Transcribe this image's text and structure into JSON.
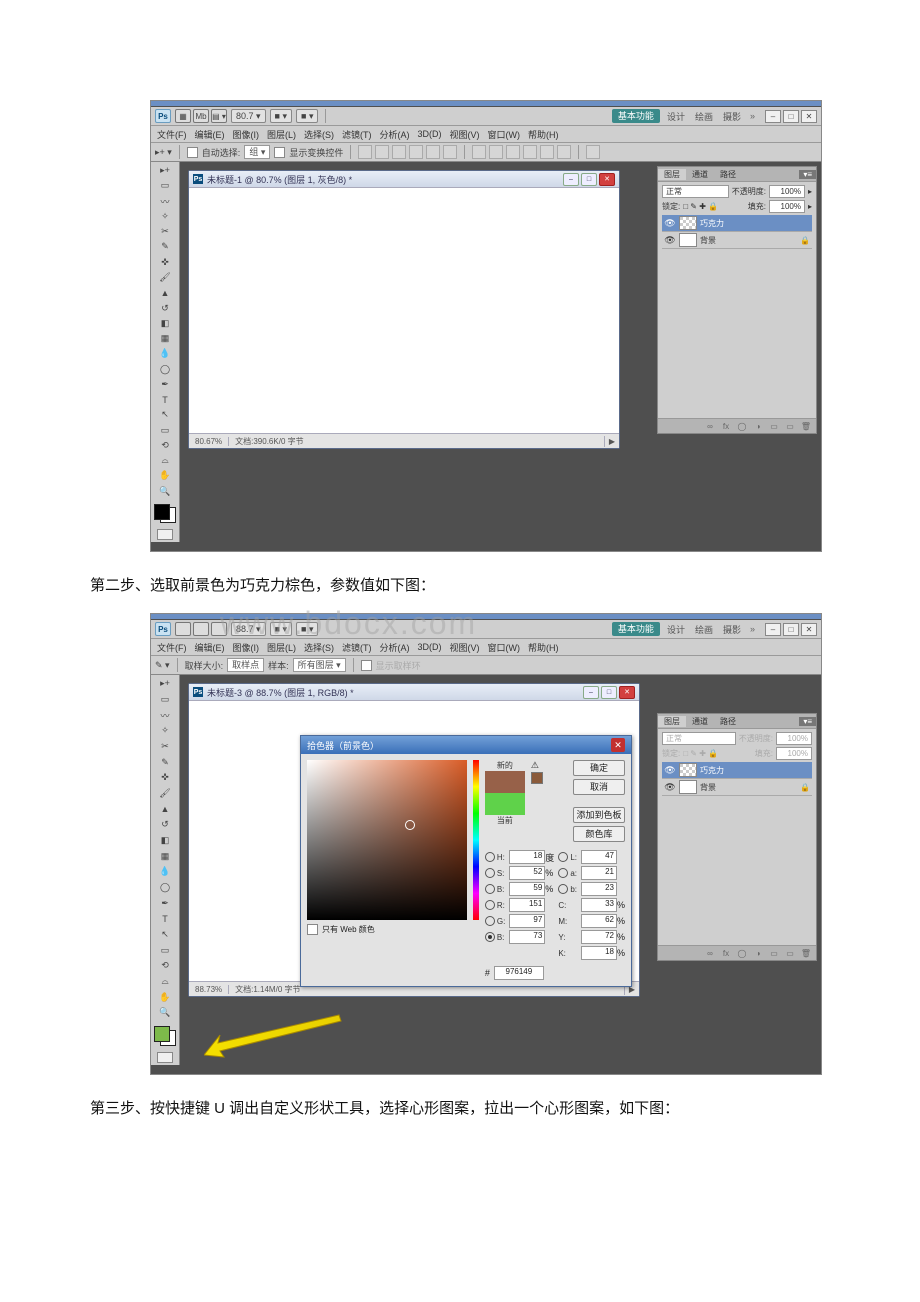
{
  "watermark": "www.bdocx.com",
  "step2_text": "第二步、选取前景色为巧克力棕色，参数值如下图：",
  "step3_text": "第三步、按快捷键 U 调出自定义形状工具，选择心形图案，拉出一个心形图案，如下图：",
  "ps": {
    "app_icon": "Ps",
    "header_icons": [
      "▦",
      "Mb",
      "▤ ▾"
    ],
    "zoom_dropdown": "80.7 ▾",
    "view_drop1": "■ ▾",
    "view_drop2": "■ ▾",
    "workspace_active": "基本功能",
    "workspace_links": [
      "设计",
      "绘画",
      "摄影"
    ],
    "arrows": "»",
    "win_buttons": [
      "–",
      "□",
      "✕"
    ],
    "menus": [
      "文件(F)",
      "编辑(E)",
      "图像(I)",
      "图层(L)",
      "选择(S)",
      "滤镜(T)",
      "分析(A)",
      "3D(D)",
      "视图(V)",
      "窗口(W)",
      "帮助(H)"
    ],
    "options1": {
      "tool": "▸+ ▾",
      "auto_select": "自动选择:",
      "auto_select_drop": "组 ▾",
      "show_transform": "显示变换控件"
    },
    "options2": {
      "tool": "✎ ▾",
      "sample_label": "取样大小:",
      "sample_value": "取样点",
      "sample_label2": "样本:",
      "sample_value2": "所有图层 ▾",
      "checkbox": "显示取样环"
    },
    "doc1": {
      "title": "未标题-1 @ 80.7% (图层 1, 灰色/8) *",
      "status_zoom": "80.67%",
      "status_info": "文档:390.6K/0 字节",
      "status_play": "▶"
    },
    "doc2": {
      "title": "未标题-3 @ 88.7% (图层 1, RGB/8) *",
      "status_zoom": "88.73%",
      "status_info": "文档:1.14M/0 字节",
      "status_play": "▶"
    },
    "panel": {
      "tabs": [
        "图层",
        "通道",
        "路径"
      ],
      "blend_mode": "正常",
      "opacity_label": "不透明度:",
      "opacity_value": "100%",
      "lock_label": "锁定:",
      "lock_icons": "□ ✎ ✚ 🔒",
      "fill_label": "填充:",
      "fill_value": "100%",
      "layer1": "巧克力",
      "layer2": "背景",
      "footer_icons": [
        "∞",
        "fx",
        "◯",
        "◑",
        "▭",
        "▭",
        "🗑"
      ]
    },
    "picker": {
      "title": "拾色器（前景色）",
      "new_label": "新的",
      "current_label": "当前",
      "btn_ok": "确定",
      "btn_cancel": "取消",
      "btn_add": "添加到色板",
      "btn_lib": "颜色库",
      "web_only": "只有 Web 颜色",
      "H": "18",
      "H_unit": "度",
      "S": "52",
      "S_unit": "%",
      "Bv": "59",
      "B_unit": "%",
      "L": "47",
      "a": "21",
      "b": "23",
      "R": "151",
      "G": "97",
      "B": "73",
      "C": "33",
      "M": "62",
      "Y": "72",
      "K": "18",
      "CMYK_unit": "%",
      "hex": "976149"
    }
  }
}
